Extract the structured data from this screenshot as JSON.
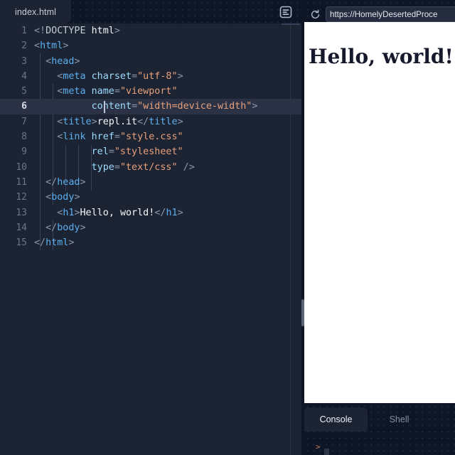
{
  "app": {
    "name": "replit-ide",
    "background_color": "#0e1525",
    "editor_background": "#1c2333"
  },
  "editor": {
    "tab": {
      "label": "index.html",
      "active": true
    },
    "format_icon": "format-lines-icon",
    "active_line": 6,
    "language": "html",
    "lines": [
      {
        "n": "1",
        "text": "<!DOCTYPE html>"
      },
      {
        "n": "2",
        "text": "<html>"
      },
      {
        "n": "3",
        "text": "  <head>"
      },
      {
        "n": "4",
        "text": "    <meta charset=\"utf-8\">"
      },
      {
        "n": "5",
        "text": "    <meta name=\"viewport\""
      },
      {
        "n": "6",
        "text": "          content=\"width=device-width\">"
      },
      {
        "n": "7",
        "text": "    <title>repl.it</title>"
      },
      {
        "n": "8",
        "text": "    <link href=\"style.css\""
      },
      {
        "n": "9",
        "text": "          rel=\"stylesheet\""
      },
      {
        "n": "10",
        "text": "          type=\"text/css\" />"
      },
      {
        "n": "11",
        "text": "  </head>"
      },
      {
        "n": "12",
        "text": "  <body>"
      },
      {
        "n": "13",
        "text": "    <h1>Hello, world!</h1>"
      },
      {
        "n": "14",
        "text": "  </body>"
      },
      {
        "n": "15",
        "text": "</html>"
      }
    ],
    "colors": {
      "tag": "#5bb0f0",
      "attribute": "#9cdcfe",
      "string": "#e8a07a",
      "punctuation": "#8b97b0",
      "text": "#f5f9fc",
      "line_number": "#6b7587",
      "active_line_bg": "#2b3245"
    }
  },
  "preview": {
    "reload_icon": "reload-icon",
    "url_value": "https://HomelyDesertedProce",
    "url_placeholder": "https://",
    "heading": "Hello, world!",
    "page_background": "#ffffff"
  },
  "console": {
    "tabs": [
      {
        "label": "Console",
        "active": true
      },
      {
        "label": "Shell",
        "active": false
      }
    ],
    "prompt": ">",
    "prompt_color": "#c08060"
  }
}
